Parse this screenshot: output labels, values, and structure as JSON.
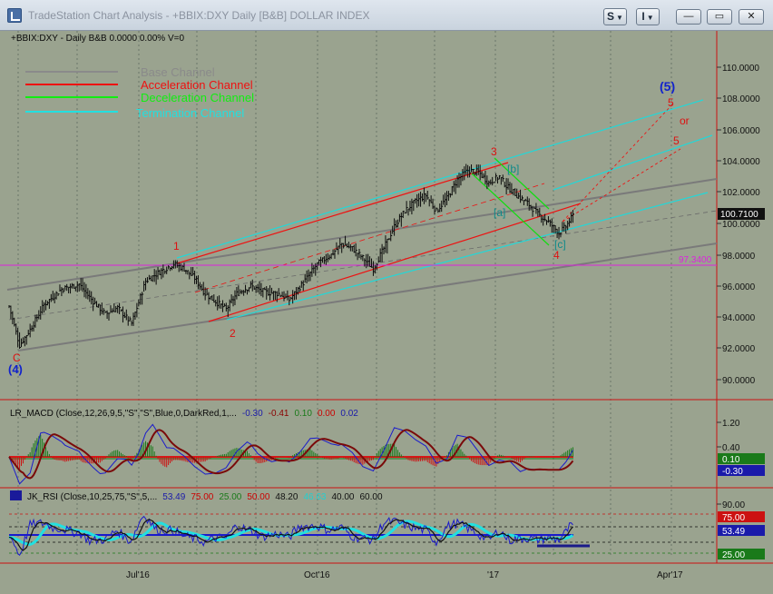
{
  "window": {
    "title": "TradeStation Chart Analysis - +BBIX:DXY Daily [B&B] DOLLAR INDEX",
    "btn_s": "S",
    "btn_i": "I",
    "minimize": "—",
    "restore": "▭",
    "close": "✕"
  },
  "price_panel": {
    "header": "+BBIX:DXY - Daily  B&B  0.0000  0.00%  V=0",
    "legend": [
      {
        "label": "Base Channel",
        "color": "#8a8a8a"
      },
      {
        "label": "Acceleration Channel",
        "color": "#ee1111"
      },
      {
        "label": "Deceleration Channel",
        "color": "#11ee11"
      },
      {
        "label": "Termination Channel",
        "color": "#22e0e0"
      }
    ],
    "last_price": "100.7100",
    "hline_label": "97.3400",
    "y_ticks": [
      "110.0000",
      "108.0000",
      "106.0000",
      "104.0000",
      "102.0000",
      "100.0000",
      "98.0000",
      "96.0000",
      "94.0000",
      "92.0000",
      "90.0000"
    ],
    "wave_labels": [
      {
        "text": "C",
        "color": "#dd1111"
      },
      {
        "text": "(4)",
        "color": "#1122cc"
      },
      {
        "text": "1",
        "color": "#dd1111"
      },
      {
        "text": "2",
        "color": "#dd1111"
      },
      {
        "text": "3",
        "color": "#dd1111"
      },
      {
        "text": "4",
        "color": "#dd1111"
      },
      {
        "text": "[a]",
        "color": "#0f8a8a"
      },
      {
        "text": "[b]",
        "color": "#0f8a8a"
      },
      {
        "text": "[c]",
        "color": "#0f8a8a"
      },
      {
        "text": "(5)",
        "color": "#1122cc"
      },
      {
        "text": "5",
        "color": "#dd1111"
      },
      {
        "text": "or",
        "color": "#dd1111"
      },
      {
        "text": "5",
        "color": "#dd1111"
      }
    ]
  },
  "macd_panel": {
    "header_prefix": "LR_MACD (Close,12,26,9,5,\"S\",\"S\",Blue,0,DarkRed,1,...",
    "values": [
      "-0.30",
      "-0.41",
      "0.10",
      "0.00",
      "0.02"
    ],
    "value_colors": [
      "#1a1aaa",
      "#8b0000",
      "#1a7a1a",
      "#cc0000",
      "#1a1aaa"
    ],
    "y_ticks": [
      "1.20",
      "0.40"
    ],
    "tag_green": "0.10",
    "tag_blue": "-0.30"
  },
  "rsi_panel": {
    "header_prefix": "JK_RSI (Close,10,25,75,\"S\",5,...",
    "values": [
      "53.49",
      "75.00",
      "25.00",
      "50.00",
      "48.20",
      "46.63",
      "40.00",
      "60.00"
    ],
    "value_colors": [
      "#1a1aaa",
      "#cc0000",
      "#1a7a1a",
      "#cc0000",
      "#111111",
      "#22d0d0",
      "#111111",
      "#111111"
    ],
    "y_ticks": [
      "90.00"
    ],
    "tag_red": "75.00",
    "tag_blue": "53.49",
    "tag_green": "25.00"
  },
  "x_axis": [
    "Jul'16",
    "Oct'16",
    "'17",
    "Apr'17"
  ],
  "chart_data": {
    "type": "ohlc",
    "title": "+BBIX:DXY Daily [B&B] DOLLAR INDEX",
    "ylim": [
      89.0,
      112.0
    ],
    "x_labels": [
      "Jul'16",
      "Oct'16",
      "'17",
      "Apr'17"
    ],
    "close_path": [
      [
        0,
        94.7
      ],
      [
        6,
        92.2
      ],
      [
        12,
        93.2
      ],
      [
        20,
        94.8
      ],
      [
        30,
        95.8
      ],
      [
        40,
        96.1
      ],
      [
        48,
        95.0
      ],
      [
        55,
        94.2
      ],
      [
        62,
        94.6
      ],
      [
        70,
        93.6
      ],
      [
        78,
        96.3
      ],
      [
        86,
        96.9
      ],
      [
        94,
        97.4
      ],
      [
        100,
        97.1
      ],
      [
        106,
        96.5
      ],
      [
        112,
        95.5
      ],
      [
        118,
        95.0
      ],
      [
        124,
        94.5
      ],
      [
        130,
        95.5
      ],
      [
        138,
        96.0
      ],
      [
        146,
        95.6
      ],
      [
        154,
        95.5
      ],
      [
        160,
        95.1
      ],
      [
        168,
        96.2
      ],
      [
        176,
        97.4
      ],
      [
        184,
        98.0
      ],
      [
        190,
        98.7
      ],
      [
        196,
        98.4
      ],
      [
        202,
        97.8
      ],
      [
        208,
        97.1
      ],
      [
        214,
        98.4
      ],
      [
        220,
        99.8
      ],
      [
        226,
        100.8
      ],
      [
        232,
        101.4
      ],
      [
        238,
        101.8
      ],
      [
        244,
        100.8
      ],
      [
        250,
        101.6
      ],
      [
        256,
        102.8
      ],
      [
        262,
        103.4
      ],
      [
        268,
        103.3
      ],
      [
        274,
        102.6
      ],
      [
        280,
        103.0
      ],
      [
        284,
        102.4
      ],
      [
        290,
        101.8
      ],
      [
        296,
        101.3
      ],
      [
        302,
        100.6
      ],
      [
        308,
        100.1
      ],
      [
        314,
        99.4
      ],
      [
        318,
        99.8
      ],
      [
        322,
        100.5
      ]
    ],
    "horizontal_line": 97.34,
    "last": 100.71,
    "macd": {
      "ylim": [
        -0.8,
        1.4
      ],
      "ticks": [
        1.2,
        0.4
      ],
      "last": -0.3,
      "signal": -0.41
    },
    "rsi": {
      "ylim": [
        5,
        95
      ],
      "ticks": [
        90
      ],
      "levels": [
        75,
        25
      ],
      "last": 53.49
    }
  }
}
